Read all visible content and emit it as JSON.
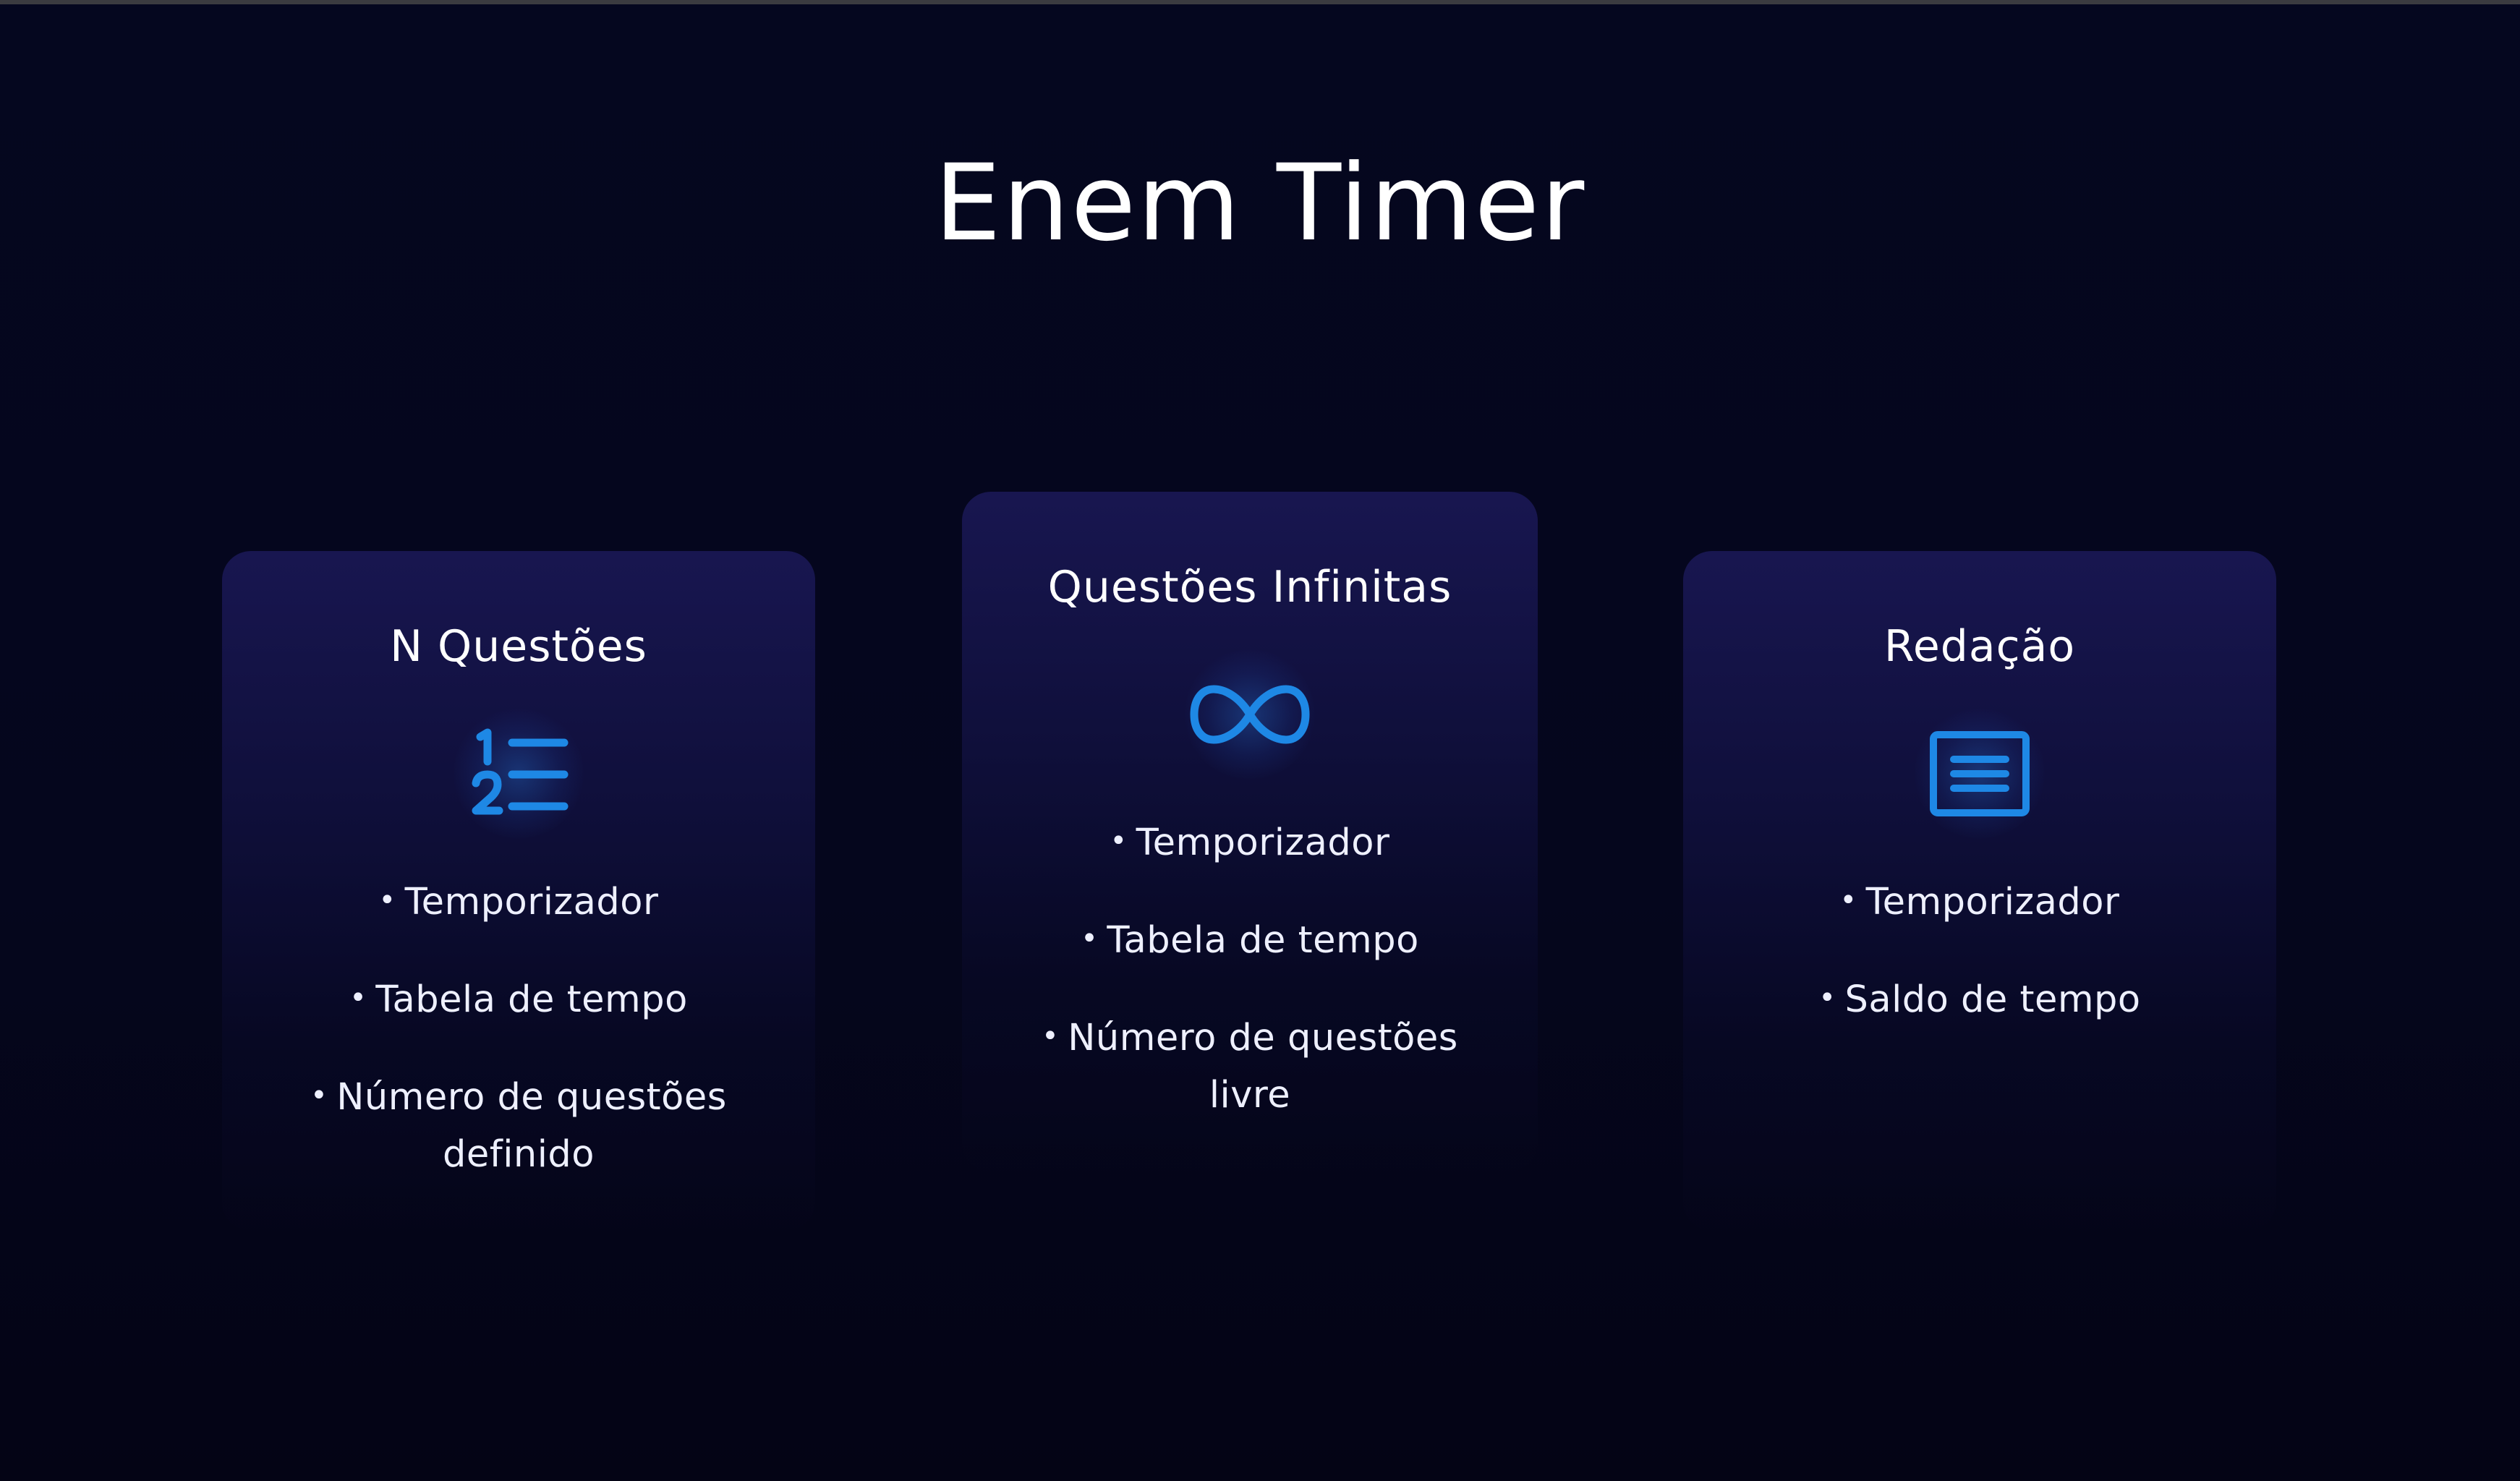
{
  "header": {
    "title": "Enem Timer"
  },
  "colors": {
    "background": "#05061f",
    "card": "#181650",
    "accent_icon": "#1e88e5",
    "text": "#ffffff"
  },
  "cards": [
    {
      "title": "N Questões",
      "icon": "numbered-list-icon",
      "features": [
        "Temporizador",
        "Tabela de tempo",
        "Número de questões definido"
      ]
    },
    {
      "title": "Questões Infinitas",
      "icon": "infinity-icon",
      "features": [
        "Temporizador",
        "Tabela de tempo",
        "Número de questões livre"
      ]
    },
    {
      "title": "Redação",
      "icon": "document-icon",
      "features": [
        "Temporizador",
        "Saldo de tempo"
      ]
    }
  ],
  "bullet": "•"
}
